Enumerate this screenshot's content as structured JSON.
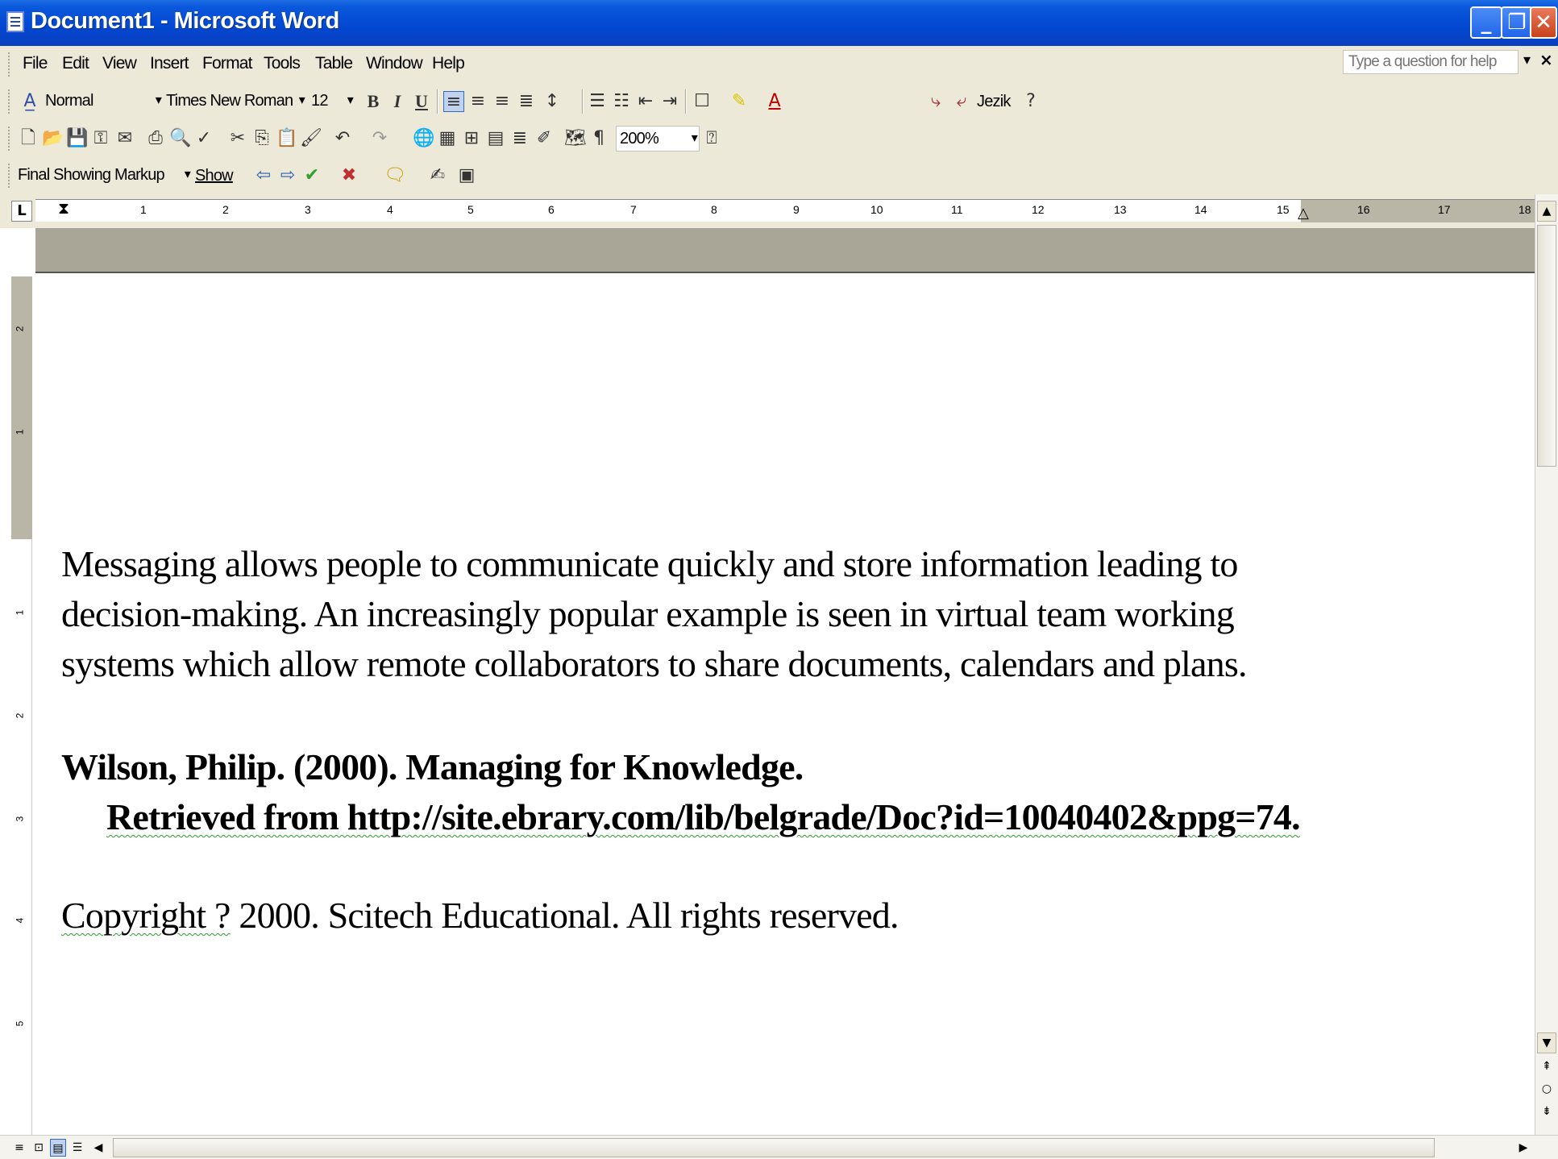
{
  "window": {
    "title": "Document1 - Microsoft Word"
  },
  "menubar": {
    "items": [
      "File",
      "Edit",
      "View",
      "Insert",
      "Format",
      "Tools",
      "Table",
      "Window",
      "Help"
    ],
    "help_placeholder": "Type a question for help"
  },
  "formatting": {
    "style": "Normal",
    "font": "Times New Roman",
    "size": "12",
    "bold": "B",
    "italic": "I",
    "underline": "U",
    "language": "Jezik"
  },
  "standard": {
    "zoom": "200%"
  },
  "reviewing": {
    "display": "Final Showing Markup",
    "show_label": "Show"
  },
  "ruler": {
    "numbers": [
      "1",
      "2",
      "3",
      "4",
      "5",
      "6",
      "7",
      "8",
      "9",
      "10",
      "11",
      "12",
      "13",
      "14",
      "15",
      "16",
      "17",
      "18"
    ],
    "vertical_numbers": [
      "2",
      "1",
      "1",
      "2",
      "3",
      "4",
      "5"
    ]
  },
  "document": {
    "paragraph_lines": [
      "Messaging allows people to communicate quickly and store information leading to",
      "decision-making. An increasingly popular example is seen in virtual team working",
      "systems which allow remote collaborators to share documents, calendars and plans."
    ],
    "citation_line1": "Wilson, Philip. (2000). Managing for Knowledge.",
    "citation_line2": "Retrieved from http://site.ebrary.com/lib/belgrade/Doc?id=10040402&ppg=74.",
    "copyright_word": "Copyright ?",
    "copyright_rest": " 2000.  Scitech Educational.  All rights reserved."
  }
}
